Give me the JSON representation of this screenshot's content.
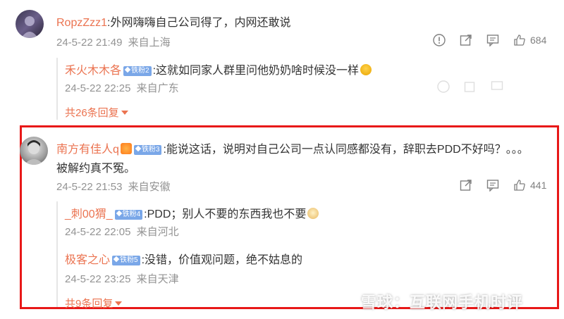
{
  "comment1": {
    "username": "RopzZzz1",
    "text": ":外网嗨嗨自己公司得了，内网还敢说",
    "time": "24-5-22 21:49",
    "location": "来自上海",
    "likes": "684"
  },
  "reply1": {
    "username": "禾火木木各",
    "badge": "铁粉2",
    "text": ":这就如同家人群里问他奶奶啥时候没一样",
    "time": "24-5-22 22:25",
    "location": "来自广东"
  },
  "more1": "共26条回复",
  "comment2": {
    "username": "南方有佳人q",
    "badge": "铁粉3",
    "text1": ":能说这话，说明对自己公司一点认同感都没有，辞职去PDD不好吗？。。。",
    "text2": "被解约真不冤。",
    "time": "24-5-22 21:53",
    "location": "来自安徽",
    "likes": "441"
  },
  "reply2": {
    "username": "_刺00猬_",
    "badge": "铁粉4",
    "text": ":PDD；别人不要的东西我也不要",
    "time": "24-5-22 22:05",
    "location": "来自河北"
  },
  "reply3": {
    "username": "极客之心",
    "badge": "铁粉5",
    "text": ":没错，价值观问题，绝不姑息的",
    "time": "24-5-22 23:25",
    "location": "来自天津"
  },
  "more2": "共9条回复",
  "watermark": "雪球：互联网手机时评",
  "colors": {
    "username": "#eb7350",
    "meta": "#939393",
    "highlight": "#e81818"
  }
}
